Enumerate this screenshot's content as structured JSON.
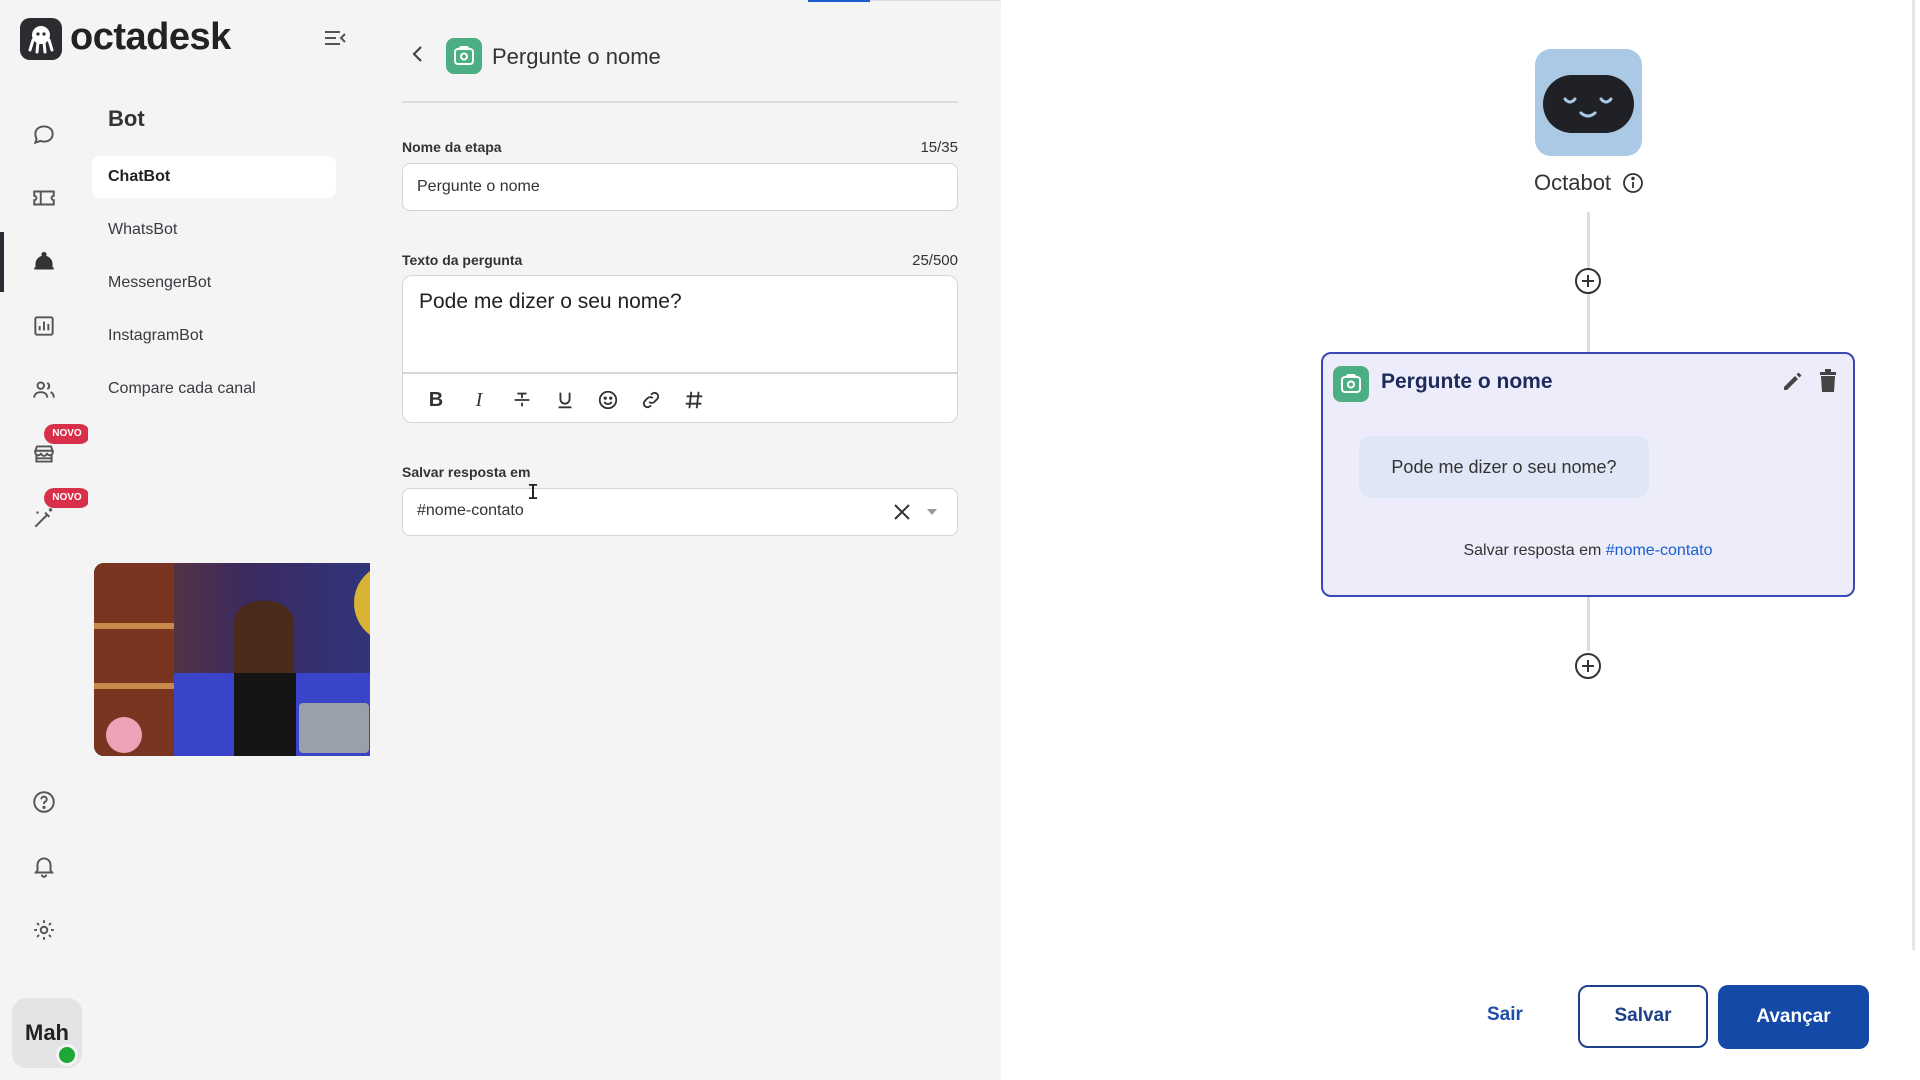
{
  "app": {
    "brand": "octadesk"
  },
  "rail": {
    "badges": {
      "apps": "NOVO",
      "ai": "NOVO"
    },
    "user": {
      "initials": "Mah",
      "status_color": "#1fa83a"
    }
  },
  "submenu": {
    "title": "Bot",
    "items": [
      {
        "label": "ChatBot",
        "active": true
      },
      {
        "label": "WhatsBot",
        "active": false
      },
      {
        "label": "MessengerBot",
        "active": false
      },
      {
        "label": "InstagramBot",
        "active": false
      },
      {
        "label": "Compare cada canal",
        "active": false
      }
    ]
  },
  "form": {
    "title": "Pergunte o nome",
    "step_name": {
      "label": "Nome da etapa",
      "count": "15/35",
      "value": "Pergunte o nome"
    },
    "question": {
      "label": "Texto da pergunta",
      "count": "25/500",
      "value": "Pode me dizer o seu nome?"
    },
    "toolbar": [
      "bold-icon",
      "italic-icon",
      "strikethrough-icon",
      "underline-icon",
      "emoji-icon",
      "link-icon",
      "hashtag-icon"
    ],
    "save_to": {
      "label": "Salvar resposta em",
      "value": "#nome-contato"
    }
  },
  "canvas": {
    "bot_name": "Octabot",
    "node": {
      "title": "Pergunte o nome",
      "message": "Pode me dizer o seu nome?",
      "save_prefix": "Salvar resposta em",
      "save_var": "#nome-contato"
    },
    "actions": {
      "exit": "Sair",
      "save": "Salvar",
      "next": "Avançar"
    }
  },
  "colors": {
    "accent": "#1449a8",
    "node_border": "#3c47b8",
    "step_icon": "#4caf83",
    "badge": "#d9304a"
  }
}
